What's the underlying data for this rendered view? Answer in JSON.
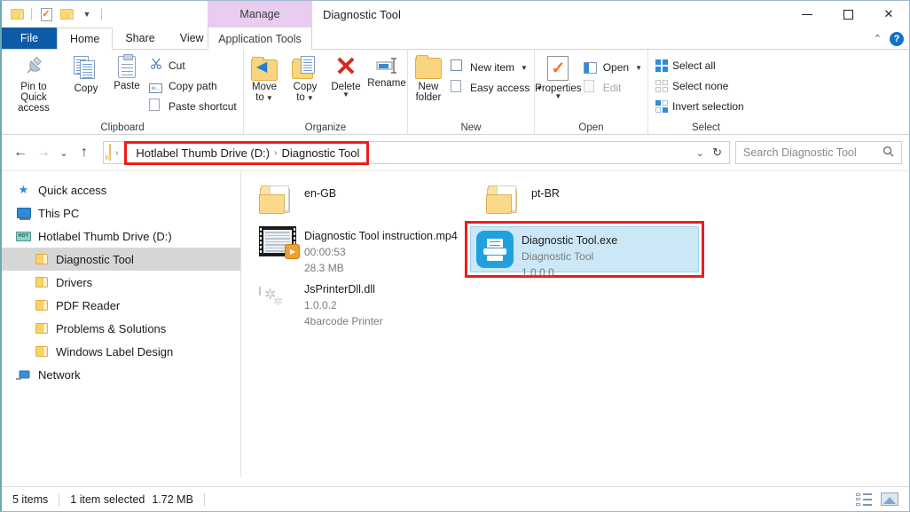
{
  "window": {
    "title": "Diagnostic Tool",
    "contextual_tab_group": "Manage",
    "minimize": "–",
    "maximize": "□",
    "close": "✕"
  },
  "quick_access_toolbar": {
    "items": [
      {
        "name": "properties-icon",
        "label": "Properties"
      },
      {
        "name": "new-folder-icon",
        "label": "New folder"
      },
      {
        "name": "customize-caret",
        "label": "▾"
      }
    ]
  },
  "tabs": [
    {
      "label": "File",
      "name": "tab-file"
    },
    {
      "label": "Home",
      "name": "tab-home"
    },
    {
      "label": "Share",
      "name": "tab-share"
    },
    {
      "label": "View",
      "name": "tab-view"
    },
    {
      "label": "Application Tools",
      "name": "tab-application-tools"
    }
  ],
  "tabbar_right": {
    "collapse_ribbon": "⌃",
    "help": "?"
  },
  "ribbon": {
    "groups": [
      {
        "title": "Clipboard",
        "big_buttons": [
          {
            "label": "Pin to Quick access",
            "icon": "pin-icon"
          },
          {
            "label": "Copy",
            "icon": "copy-icon"
          },
          {
            "label": "Paste",
            "icon": "paste-icon"
          }
        ],
        "small_buttons": [
          {
            "label": "Cut",
            "icon": "scissors-icon"
          },
          {
            "label": "Copy path",
            "icon": "copy-path-icon"
          },
          {
            "label": "Paste shortcut",
            "icon": "paste-shortcut-icon"
          }
        ]
      },
      {
        "title": "Organize",
        "big_buttons": [
          {
            "label": "Move to",
            "icon": "move-to-icon",
            "caret": "▾"
          },
          {
            "label": "Copy to",
            "icon": "copy-to-icon",
            "caret": "▾"
          },
          {
            "label": "Delete",
            "icon": "delete-icon",
            "caret": "▾"
          },
          {
            "label": "Rename",
            "icon": "rename-icon"
          }
        ],
        "small_buttons": []
      },
      {
        "title": "New",
        "big_buttons": [
          {
            "label": "New folder",
            "icon": "new-folder-icon"
          }
        ],
        "small_buttons": [
          {
            "label": "New item",
            "icon": "new-item-icon",
            "caret": "▾"
          },
          {
            "label": "Easy access",
            "icon": "easy-access-icon",
            "caret": "▾"
          }
        ]
      },
      {
        "title": "Open",
        "big_buttons": [
          {
            "label": "Properties",
            "icon": "properties-icon",
            "caret": "▾"
          }
        ],
        "small_buttons": [
          {
            "label": "Open",
            "icon": "open-icon",
            "caret": "▾"
          },
          {
            "label": "Edit",
            "icon": "edit-icon",
            "disabled": true
          }
        ]
      },
      {
        "title": "Select",
        "big_buttons": [],
        "small_buttons": [
          {
            "label": "Select all",
            "icon": "select-all-icon"
          },
          {
            "label": "Select none",
            "icon": "select-none-icon"
          },
          {
            "label": "Invert selection",
            "icon": "invert-selection-icon"
          }
        ]
      }
    ]
  },
  "address_bar": {
    "back": "←",
    "forward": "→",
    "recent": "⌄",
    "up": "↑",
    "breadcrumbs": [
      {
        "label": "Hotlabel Thumb Drive (D:)"
      },
      {
        "label": "Diagnostic Tool"
      }
    ],
    "crumb_separator": "›",
    "dropdown_caret": "⌄",
    "refresh": "↻",
    "highlight_color": "#ee1c1c"
  },
  "search": {
    "placeholder": "Search Diagnostic Tool",
    "icon": "search-icon"
  },
  "sidebar": {
    "items": [
      {
        "label": "Quick access",
        "icon": "star-pin-icon",
        "indent": false,
        "selected": false
      },
      {
        "label": "This PC",
        "icon": "this-pc-icon",
        "indent": false,
        "selected": false
      },
      {
        "label": "Hotlabel Thumb Drive (D:)",
        "icon": "usb-drive-icon",
        "indent": false,
        "selected": false
      },
      {
        "label": "Diagnostic Tool",
        "icon": "folder-icon",
        "indent": true,
        "selected": true
      },
      {
        "label": "Drivers",
        "icon": "folder-icon",
        "indent": true,
        "selected": false
      },
      {
        "label": "PDF Reader",
        "icon": "folder-icon",
        "indent": true,
        "selected": false
      },
      {
        "label": "Problems & Solutions",
        "icon": "folder-icon",
        "indent": true,
        "selected": false
      },
      {
        "label": "Windows Label Design",
        "icon": "folder-icon",
        "indent": true,
        "selected": false
      },
      {
        "label": "Network",
        "icon": "network-icon",
        "indent": false,
        "selected": false
      }
    ],
    "usb_badge_text": "HOT"
  },
  "files": [
    {
      "name": "en-GB",
      "lines": [],
      "icon": "folder-with-gear-icon",
      "selected": false
    },
    {
      "name": "pt-BR",
      "lines": [],
      "icon": "folder-with-gear-icon",
      "selected": false
    },
    {
      "name": "Diagnostic Tool instruction.mp4",
      "lines": [
        "00:00:53",
        "28.3 MB"
      ],
      "icon": "video-file-icon",
      "selected": false
    },
    {
      "name": "Diagnostic Tool.exe",
      "lines": [
        "Diagnostic Tool",
        "1.0.0.0"
      ],
      "icon": "printer-app-icon",
      "selected": true
    },
    {
      "name": "JsPrinterDll.dll",
      "lines": [
        "1.0.0.2",
        "4barcode Printer"
      ],
      "icon": "dll-file-icon",
      "selected": false
    }
  ],
  "status_bar": {
    "item_count": "5 items",
    "selection": "1 item selected",
    "selection_size": "1.72 MB",
    "view_details_icon": "details-view-icon",
    "view_large_icons_icon": "large-icons-view-icon"
  }
}
